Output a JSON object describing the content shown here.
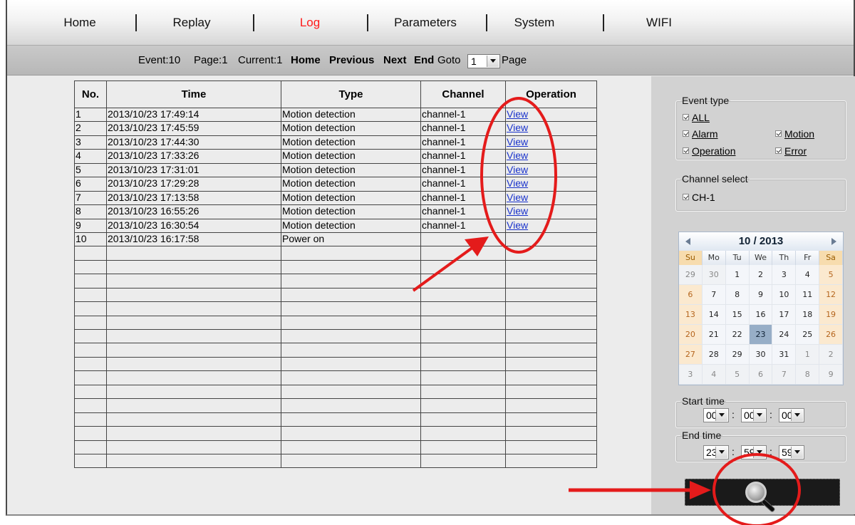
{
  "nav": {
    "items": [
      {
        "label": "Home"
      },
      {
        "label": "Replay"
      },
      {
        "label": "Log"
      },
      {
        "label": "Parameters"
      },
      {
        "label": "System"
      },
      {
        "label": "WIFI"
      }
    ],
    "active": "Log"
  },
  "pager": {
    "event": "Event:10",
    "page": "Page:1",
    "current": "Current:1",
    "home": "Home",
    "previous": "Previous",
    "next": "Next",
    "end": "End",
    "goto_label": "Goto",
    "goto_value": "1",
    "page_suffix": "Page"
  },
  "table": {
    "headers": [
      "No.",
      "Time",
      "Type",
      "Channel",
      "Operation"
    ],
    "rows": [
      [
        "1",
        "2013/10/23 17:49:14",
        "Motion detection",
        "channel-1",
        "View"
      ],
      [
        "2",
        "2013/10/23 17:45:59",
        "Motion detection",
        "channel-1",
        "View"
      ],
      [
        "3",
        "2013/10/23 17:44:30",
        "Motion detection",
        "channel-1",
        "View"
      ],
      [
        "4",
        "2013/10/23 17:33:26",
        "Motion detection",
        "channel-1",
        "View"
      ],
      [
        "5",
        "2013/10/23 17:31:01",
        "Motion detection",
        "channel-1",
        "View"
      ],
      [
        "6",
        "2013/10/23 17:29:28",
        "Motion detection",
        "channel-1",
        "View"
      ],
      [
        "7",
        "2013/10/23 17:13:58",
        "Motion detection",
        "channel-1",
        "View"
      ],
      [
        "8",
        "2013/10/23 16:55:26",
        "Motion detection",
        "channel-1",
        "View"
      ],
      [
        "9",
        "2013/10/23 16:30:54",
        "Motion detection",
        "channel-1",
        "View"
      ],
      [
        "10",
        "2013/10/23 16:17:58",
        "Power on",
        "",
        ""
      ]
    ],
    "empty_rows": 16
  },
  "event_type": {
    "legend": "Event type",
    "all": "ALL",
    "alarm": "Alarm",
    "motion": "Motion",
    "operation": "Operation",
    "error": "Error"
  },
  "channel_select": {
    "legend": "Channel select",
    "ch1": "CH-1"
  },
  "calendar": {
    "month_label": "10 / 2013",
    "weekdays": [
      "Su",
      "Mo",
      "Tu",
      "We",
      "Th",
      "Fr",
      "Sa"
    ],
    "weeks": [
      [
        "29",
        "30",
        "1",
        "2",
        "3",
        "4",
        "5"
      ],
      [
        "6",
        "7",
        "8",
        "9",
        "10",
        "11",
        "12"
      ],
      [
        "13",
        "14",
        "15",
        "16",
        "17",
        "18",
        "19"
      ],
      [
        "20",
        "21",
        "22",
        "23",
        "24",
        "25",
        "26"
      ],
      [
        "27",
        "28",
        "29",
        "30",
        "31",
        "1",
        "2"
      ],
      [
        "3",
        "4",
        "5",
        "6",
        "7",
        "8",
        "9"
      ]
    ],
    "selected": "23"
  },
  "start_time": {
    "legend": "Start time",
    "hh": "00",
    "mm": "00",
    "ss": "00"
  },
  "end_time": {
    "legend": "End time",
    "hh": "23",
    "mm": "59",
    "ss": "59"
  },
  "colors": {
    "active_nav": "#ff1a1a",
    "annotation": "#e41b1b",
    "link": "#1a33cc"
  }
}
